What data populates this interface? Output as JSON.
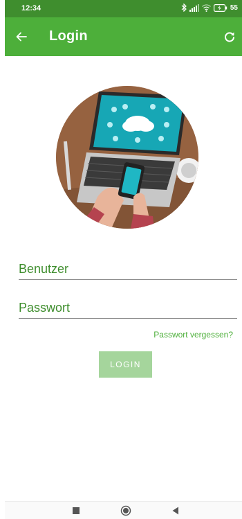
{
  "status_bar": {
    "time": "12:34",
    "battery": "55",
    "icons": [
      "bluetooth-icon",
      "signal-icon",
      "wifi-icon",
      "battery-charging-icon"
    ]
  },
  "app_bar": {
    "title": "Login",
    "back_icon": "arrow-left-icon",
    "refresh_icon": "refresh-icon",
    "color": "#4daf3a"
  },
  "form": {
    "username_placeholder": "Benutzer",
    "username_value": "",
    "password_placeholder": "Passwort",
    "password_value": "",
    "forgot_password": "Passwort vergessen?",
    "login_button": "LOGIN"
  },
  "nav_bar": {
    "icons": [
      "recents-square-icon",
      "home-circle-icon",
      "back-triangle-icon"
    ]
  },
  "colors": {
    "primary": "#4daf3a",
    "primary_dark": "#3f8e2e",
    "button_disabled": "#a5d59c"
  }
}
